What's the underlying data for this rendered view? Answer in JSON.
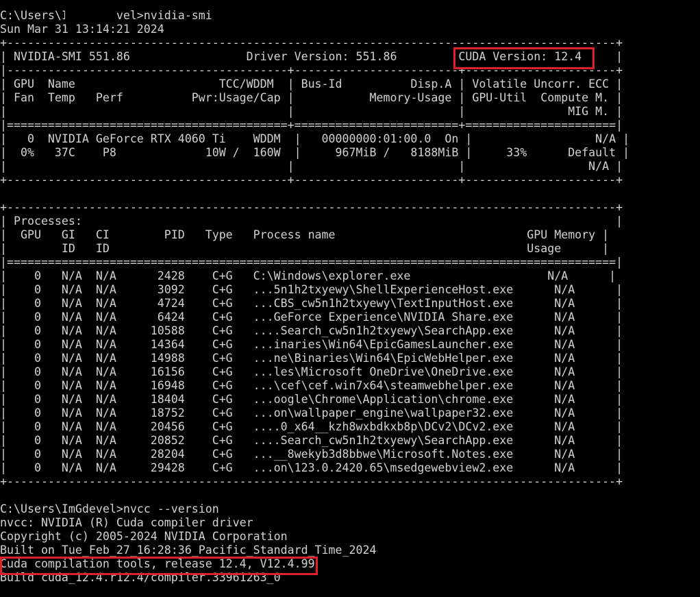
{
  "terminal": {
    "background": "#000000",
    "foreground": "#d2d2d2",
    "highlight_color": "#e0202a",
    "lines": [
      "C:\\Users\\I       vel>nvidia-smi",
      "Sun Mar 31 13:14:21 2024",
      "+-----------------------------------------------------------------------------------------+",
      "| NVIDIA-SMI 551.86                 Driver Version: 551.86         CUDA Version: 12.4     |",
      "|-----------------------------------------+------------------------+----------------------+",
      "| GPU  Name                     TCC/WDDM  | Bus-Id          Disp.A | Volatile Uncorr. ECC |",
      "| Fan  Temp   Perf          Pwr:Usage/Cap |           Memory-Usage | GPU-Util  Compute M. |",
      "|                                         |                        |               MIG M. |",
      "|=========================================+========================+======================|",
      "|   0  NVIDIA GeForce RTX 4060 Ti    WDDM  |   00000000:01:00.0  On |                  N/A |",
      "|  0%   37C    P8             10W /  160W  |     967MiB /   8188MiB |     33%      Default |",
      "|                                         |                        |                  N/A |",
      "+-----------------------------------------+------------------------+----------------------+",
      "",
      "+-----------------------------------------------------------------------------------------+",
      "| Processes:                                                                              |",
      "|  GPU   GI   CI        PID   Type   Process name                            GPU Memory |",
      "|        ID   ID                                                             Usage      |",
      "|=========================================================================================|",
      "|    0   N/A  N/A      2428    C+G   C:\\Windows\\explorer.exe                    N/A      |",
      "|    0   N/A  N/A      3092    C+G   ...5n1h2txyewy\\ShellExperienceHost.exe      N/A      |",
      "|    0   N/A  N/A      4724    C+G   ...CBS_cw5n1h2txyewy\\TextInputHost.exe      N/A      |",
      "|    0   N/A  N/A      6424    C+G   ...GeForce Experience\\NVIDIA Share.exe      N/A      |",
      "|    0   N/A  N/A     10588    C+G   ....Search_cw5n1h2txyewy\\SearchApp.exe      N/A      |",
      "|    0   N/A  N/A     14364    C+G   ...inaries\\Win64\\EpicGamesLauncher.exe      N/A      |",
      "|    0   N/A  N/A     14988    C+G   ...ne\\Binaries\\Win64\\EpicWebHelper.exe      N/A      |",
      "|    0   N/A  N/A     16156    C+G   ...les\\Microsoft OneDrive\\OneDrive.exe      N/A      |",
      "|    0   N/A  N/A     16948    C+G   ...\\cef\\cef.win7x64\\steamwebhelper.exe      N/A      |",
      "|    0   N/A  N/A     18404    C+G   ...oogle\\Chrome\\Application\\chrome.exe      N/A      |",
      "|    0   N/A  N/A     18752    C+G   ...on\\wallpaper_engine\\wallpaper32.exe      N/A      |",
      "|    0   N/A  N/A     20456    C+G   ....0_x64__kzh8wxbdkxb8p\\DCv2\\DCv2.exe      N/A      |",
      "|    0   N/A  N/A     20852    C+G   ....Search_cw5n1h2txyewy\\SearchApp.exe      N/A      |",
      "|    0   N/A  N/A     28204    C+G   ...__8wekyb3d8bbwe\\Microsoft.Notes.exe      N/A      |",
      "|    0   N/A  N/A     29428    C+G   ...on\\123.0.2420.65\\msedgewebview2.exe      N/A      |",
      "+-----------------------------------------------------------------------------------------+",
      "",
      "C:\\Users\\ImGdevel>nvcc --version",
      "nvcc: NVIDIA (R) Cuda compiler driver",
      "Copyright (c) 2005-2024 NVIDIA Corporation",
      "Built on Tue_Feb_27_16:28:36_Pacific_Standard_Time_2024",
      "Cuda compilation tools, release 12.4, V12.4.99",
      "Build cuda_12.4.r12.4/compiler.33961263_0"
    ]
  }
}
